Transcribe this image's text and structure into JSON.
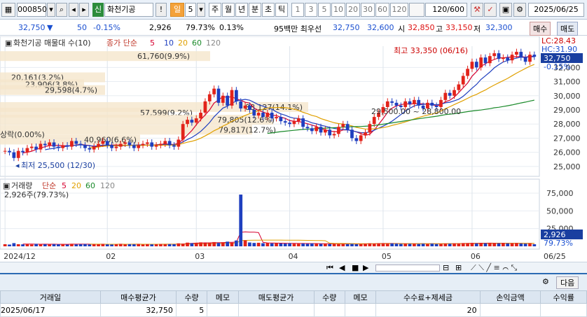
{
  "toolbar": {
    "code": "000850",
    "badge": "신",
    "name": "화천기공",
    "count": "5",
    "period_tabs": [
      "일",
      "주",
      "월",
      "년",
      "분",
      "초",
      "틱"
    ],
    "interval_tabs": [
      "1",
      "3",
      "5",
      "10",
      "20",
      "30",
      "60",
      "120"
    ],
    "view_count": "120/600",
    "date": "2025/06/25"
  },
  "quote": {
    "price": "32,750",
    "arrow": "▼",
    "change": "50",
    "change_pct": "-0.15%",
    "volume": "2,926",
    "vol_ratio": "79.73%",
    "turnover": "0.13%",
    "priority": "95백만 최우선",
    "ask": "32,750",
    "bid": "32,600",
    "open_label": "시",
    "open": "32,850",
    "high_label": "고",
    "high": "33,150",
    "low_label": "저",
    "low": "32,300",
    "buy_label": "매수",
    "sell_label": "매도"
  },
  "price_panel": {
    "title": "화천기공 매물대 수(10)",
    "ma_label": "종가 단순",
    "ma_periods": [
      "5",
      "10",
      "20",
      "60",
      "120"
    ],
    "lc_label": "LC:28.43",
    "hc_label": "HC:31.90",
    "current_price": "32,750",
    "current_pct": "-0.15%",
    "high_note": "최고 33,350 (06/16)",
    "low_note": "최저 25,500 (12/30)",
    "range_note": "29,500.00 ~ 28,800.00",
    "left_note": "상락(0.00%)"
  },
  "volume_panel": {
    "title": "거래량",
    "ma_label": "단순",
    "ma_periods": [
      "5",
      "20",
      "60",
      "120"
    ],
    "today_note": "2,926주(79.73%)",
    "last_volume": "2,926",
    "last_pct": "79.73%"
  },
  "volume_profile": [
    {
      "label": "61,760(9.9%)"
    },
    {
      "label": "20,161(3.2%)"
    },
    {
      "label": "23,906(3.8%)"
    },
    {
      "label": "29,598(4.7%)"
    },
    {
      "label": "88,127(14.1%)"
    },
    {
      "label": "57,599(9.2%)"
    },
    {
      "label": "79,805(12.6%)"
    },
    {
      "label": "79,817(12.7%)"
    },
    {
      "label": "40,960(6.6%)"
    }
  ],
  "x_dates": [
    "2024/12",
    "02",
    "03",
    "04",
    "05",
    "06",
    "06/25"
  ],
  "trade_table": {
    "next_label": "다음",
    "headers": [
      "거래일",
      "매수평균가",
      "수량",
      "메모",
      "매도평균가",
      "수량",
      "메모",
      "수수료+제세금",
      "손익금액",
      "수익률"
    ],
    "rows": [
      [
        "2025/06/17",
        "32,750",
        "5",
        "",
        "",
        "",
        "",
        "20",
        "",
        ""
      ]
    ]
  },
  "chart_data": {
    "type": "candlestick",
    "y_axis": {
      "min": 24500,
      "max": 33500,
      "ticks": [
        25000,
        26000,
        27000,
        28000,
        29000,
        30000,
        31000,
        32000
      ]
    },
    "volume_axis": {
      "min": 0,
      "max": 77000,
      "ticks": [
        25000,
        50000,
        75000
      ]
    },
    "closes": [
      26100,
      26000,
      25600,
      26100,
      26000,
      26300,
      26400,
      26200,
      26600,
      26500,
      26700,
      26400,
      26300,
      26500,
      26400,
      26800,
      26600,
      26500,
      26300,
      26200,
      26400,
      26600,
      26800,
      26500,
      26300,
      26400,
      26600,
      26700,
      26500,
      26300,
      26500,
      26600,
      26700,
      26400,
      26500,
      26600,
      26800,
      26500,
      26400,
      26900,
      28000,
      28300,
      28100,
      28400,
      28800,
      29600,
      30100,
      30500,
      29500,
      30000,
      29300,
      30400,
      29600,
      29100,
      29300,
      29000,
      28600,
      28800,
      28500,
      28800,
      28400,
      28500,
      28200,
      28100,
      28000,
      28200,
      28400,
      27800,
      27700,
      27500,
      27800,
      27400,
      27600,
      27200,
      27300,
      27800,
      28000,
      27600,
      27000,
      26800,
      27200,
      27400,
      28000,
      28500,
      28800,
      29200,
      29600,
      29500,
      29300,
      29200,
      29600,
      29400,
      29700,
      29300,
      29100,
      29500,
      29300,
      29200,
      29700,
      30200,
      30000,
      30400,
      30800,
      31400,
      31900,
      32400,
      32000,
      32700,
      32300,
      32800,
      33000,
      32600,
      32700,
      32500,
      32900,
      33100,
      32700,
      32400,
      32900,
      32750
    ],
    "volumes": [
      3000,
      2500,
      4500,
      3000,
      2800,
      3200,
      2600,
      3500,
      2800,
      3000,
      2700,
      3100,
      2900,
      3300,
      2500,
      3600,
      2800,
      3000,
      3200,
      2700,
      3100,
      2900,
      3300,
      2800,
      2600,
      3000,
      3400,
      2800,
      3100,
      2900,
      3200,
      2700,
      3100,
      2800,
      3000,
      3300,
      2900,
      3100,
      3000,
      4200,
      3800,
      5200,
      4400,
      5000,
      5600,
      4500,
      5200,
      6000,
      4800,
      5800,
      6600,
      5200,
      8200,
      73000,
      8500,
      5400,
      4800,
      5000,
      4400,
      4700,
      4200,
      4600,
      4100,
      3900,
      4300,
      3800,
      4200,
      4000,
      3600,
      4100,
      3800,
      3500,
      3900,
      3300,
      3700,
      3400,
      3600,
      3200,
      3500,
      3000,
      3400,
      3800,
      4200,
      3900,
      4300,
      4000,
      3700,
      4100,
      3800,
      3500,
      3900,
      3600,
      3800,
      3400,
      3700,
      3500,
      3800,
      3300,
      3600,
      3900,
      3700,
      4200,
      4000,
      4500,
      4300,
      4700,
      4100,
      4600,
      4300,
      4900,
      4400,
      4200,
      4500,
      4100,
      4300,
      4600,
      4000,
      3800,
      4200,
      2926
    ]
  }
}
